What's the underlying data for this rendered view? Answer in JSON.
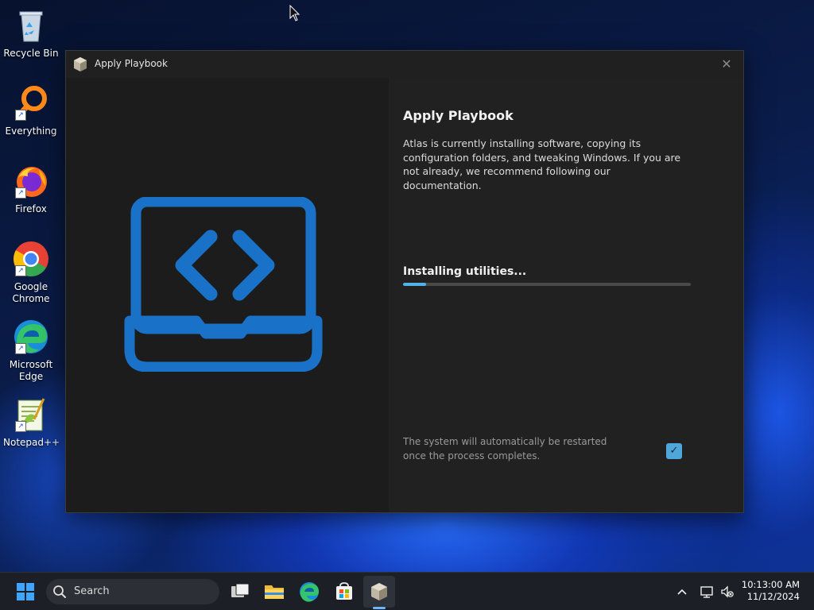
{
  "desktop": {
    "icons": [
      {
        "label": "Recycle Bin"
      },
      {
        "label": "Everything"
      },
      {
        "label": "Firefox"
      },
      {
        "label": "Google Chrome"
      },
      {
        "label": "Microsoft Edge"
      },
      {
        "label": "Notepad++"
      }
    ]
  },
  "window": {
    "title": "Apply Playbook",
    "close_glyph": "✕",
    "heading": "Apply Playbook",
    "description": "Atlas is currently installing software, copying its configuration folders, and tweaking Windows. If you are not already, we recommend following our documentation.",
    "status": "Installing utilities...",
    "progress": 0.08,
    "restart_note": "The system will automatically be restarted once the process completes.",
    "restart_checked": true,
    "check_glyph": "✓"
  },
  "taskbar": {
    "search_label": "Search",
    "time": "10:13:00 AM",
    "date": "11/12/2024"
  },
  "colors": {
    "accent": "#4fb3e8",
    "illustration": "#1a72c8"
  }
}
